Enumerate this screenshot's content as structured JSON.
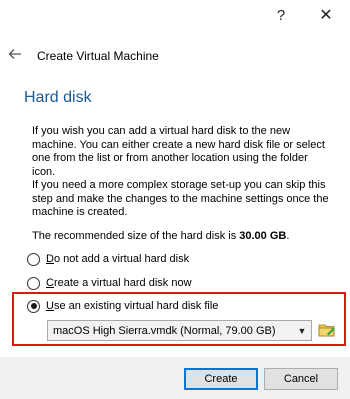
{
  "titlebar": {
    "help_icon": "?",
    "close_icon": "✕"
  },
  "header": {
    "title": "Create Virtual Machine"
  },
  "section": {
    "heading": "Hard disk"
  },
  "body": {
    "para1": "If you wish you can add a virtual hard disk to the new machine. You can either create a new hard disk file or select one from the list or from another location using the folder icon.",
    "para2": "If you need a more complex storage set-up you can skip this step and make the changes to the machine settings once the machine is created.",
    "recommended_prefix": "The recommended size of the hard disk is ",
    "recommended_value": "30.00 GB",
    "recommended_suffix": "."
  },
  "options": [
    {
      "mnemonic": "D",
      "rest": "o not add a virtual hard disk",
      "checked": false
    },
    {
      "mnemonic": "C",
      "rest": "reate a virtual hard disk now",
      "checked": false
    },
    {
      "mnemonic": "U",
      "rest": "se an existing virtual hard disk file",
      "checked": true
    }
  ],
  "disk_select": {
    "value": "macOS High Sierra.vmdk (Normal, 79.00 GB)"
  },
  "buttons": {
    "create": "Create",
    "cancel": "Cancel"
  },
  "colors": {
    "heading": "#1a5a96",
    "highlight": "#e01515",
    "default_button_border": "#0078d7"
  }
}
